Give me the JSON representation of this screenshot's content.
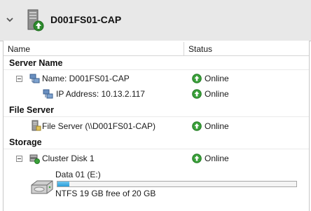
{
  "header": {
    "title": "D001FS01-CAP"
  },
  "columns": {
    "name": "Name",
    "status": "Status"
  },
  "groups": {
    "server_name": "Server Name",
    "file_server": "File Server",
    "storage": "Storage"
  },
  "rows": {
    "name": {
      "label": "Name: D001FS01-CAP",
      "status": "Online"
    },
    "ip": {
      "label": "IP Address: 10.13.2.117",
      "status": "Online"
    },
    "file_server": {
      "label": "File Server (\\\\D001FS01-CAP)",
      "status": "Online"
    },
    "cluster_disk": {
      "label": "Cluster Disk 1",
      "status": "Online"
    }
  },
  "volume": {
    "name": "Data 01 (E:)",
    "info": "NTFS 19 GB free of 20 GB",
    "used_fraction": 0.05
  },
  "colors": {
    "online_green": "#3aa03a",
    "progress_blue": "#2a9ed9"
  }
}
